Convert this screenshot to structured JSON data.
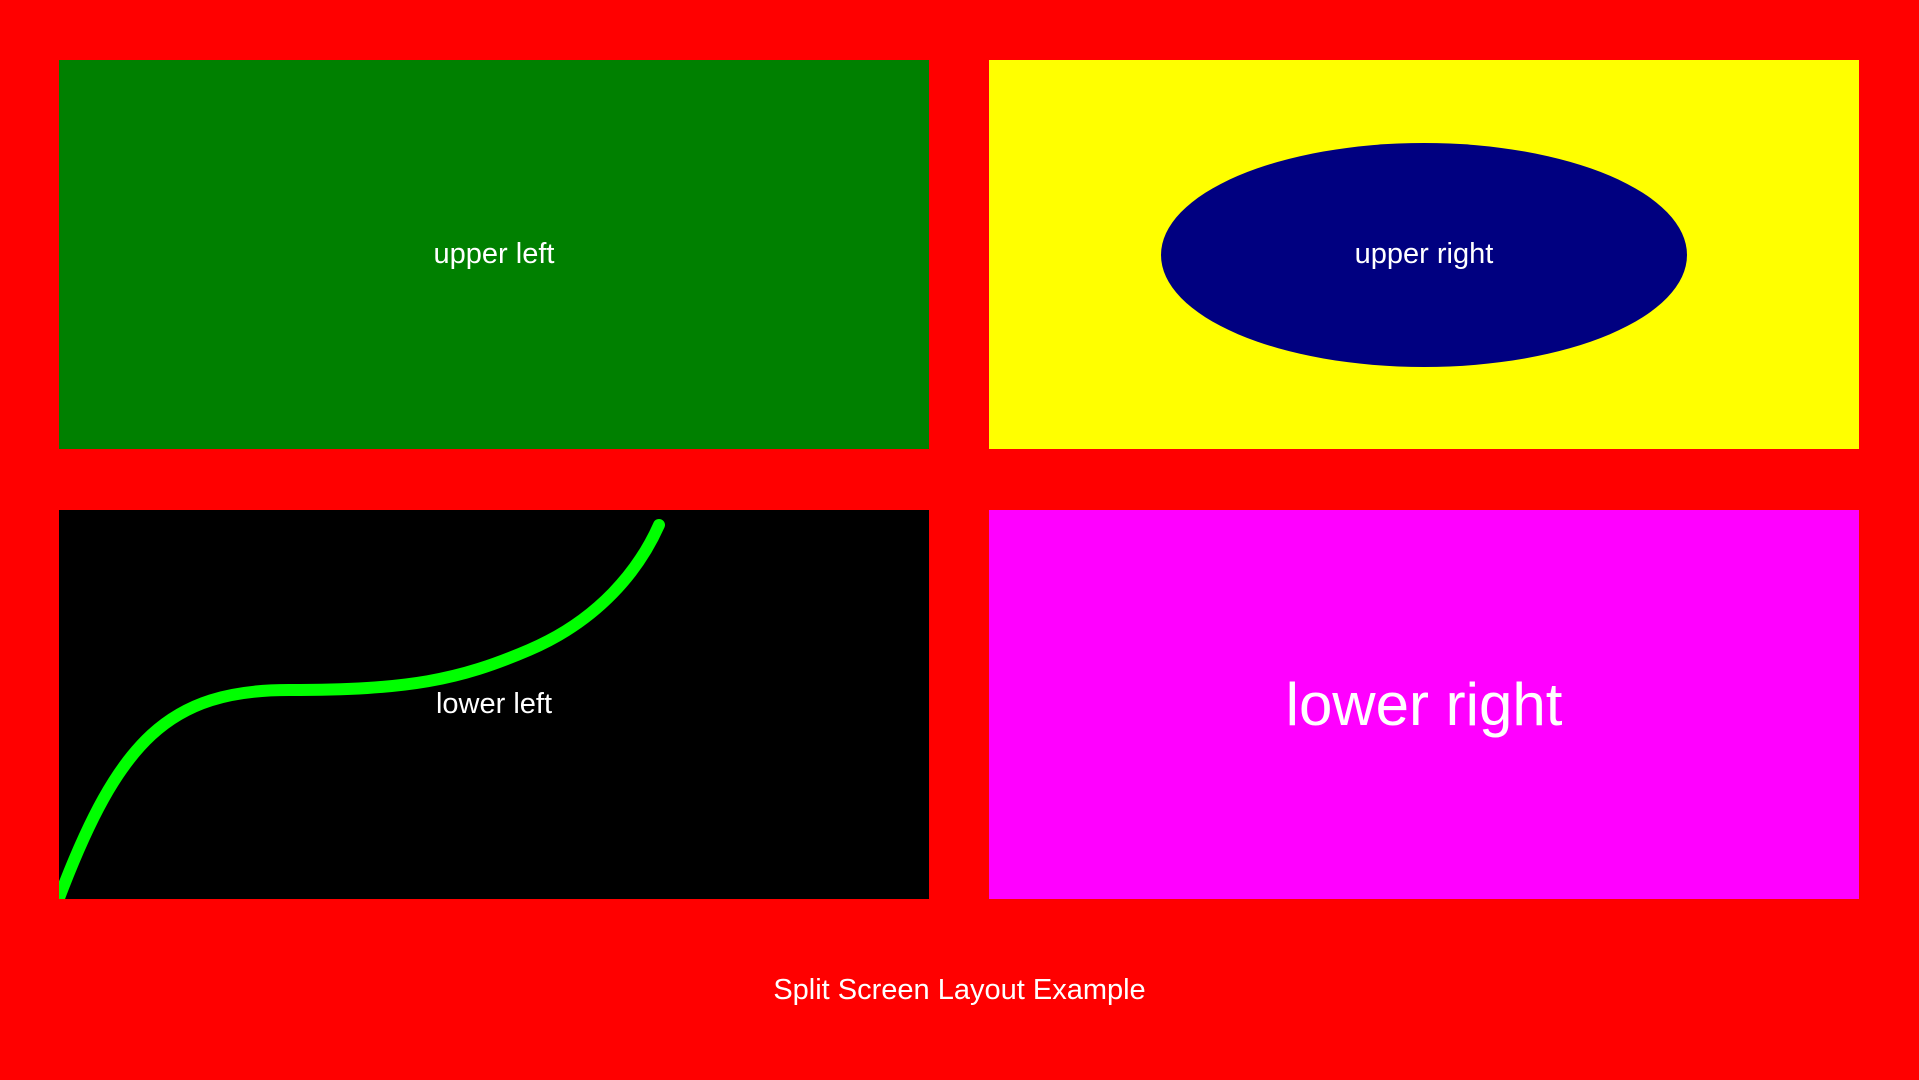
{
  "panels": {
    "upper_left": {
      "label": "upper left",
      "background": "#008000"
    },
    "upper_right": {
      "label": "upper right",
      "background": "#ffff00",
      "ellipse_color": "#000080"
    },
    "lower_left": {
      "label": "lower left",
      "background": "#000000",
      "curve_color": "#00ff00"
    },
    "lower_right": {
      "label": "lower right",
      "background": "#ff00ff"
    }
  },
  "footer": {
    "text": "Split Screen Layout Example"
  },
  "colors": {
    "background": "#ff0000",
    "text": "#ffffff"
  }
}
